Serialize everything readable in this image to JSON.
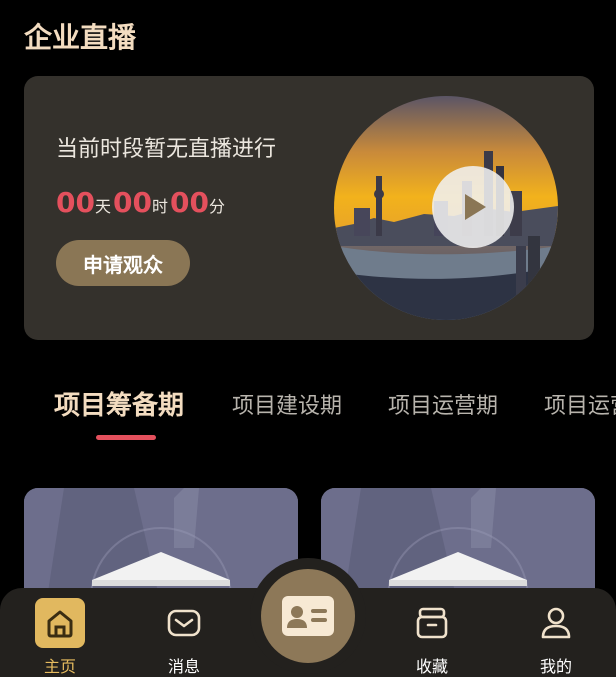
{
  "page": {
    "title": "企业直播"
  },
  "live": {
    "status_text": "当前时段暂无直播进行",
    "countdown": {
      "days": "00",
      "days_unit": "天",
      "hours": "00",
      "hours_unit": "时",
      "minutes": "00",
      "minutes_unit": "分"
    },
    "apply_label": "申请观众",
    "cover_icon": "city-skyline-image",
    "play_icon": "play-icon"
  },
  "tabs": [
    {
      "label": "项目筹备期",
      "active": true
    },
    {
      "label": "项目建设期",
      "active": false
    },
    {
      "label": "项目运营期",
      "active": false
    },
    {
      "label": "项目运营期",
      "active": false
    }
  ],
  "bottom_nav": {
    "items": [
      {
        "label": "主页",
        "icon": "home-icon",
        "active": true
      },
      {
        "label": "消息",
        "icon": "message-icon",
        "active": false
      },
      {
        "label": "",
        "icon": "id-card-icon",
        "active": false
      },
      {
        "label": "收藏",
        "icon": "archive-icon",
        "active": false
      },
      {
        "label": "我的",
        "icon": "user-icon",
        "active": false
      }
    ]
  },
  "colors": {
    "accent_red": "#e4505d",
    "gold": "#e1b85f",
    "title": "#f3dcc0",
    "card_bg": "#34312c",
    "button_bg": "#8a7655"
  }
}
